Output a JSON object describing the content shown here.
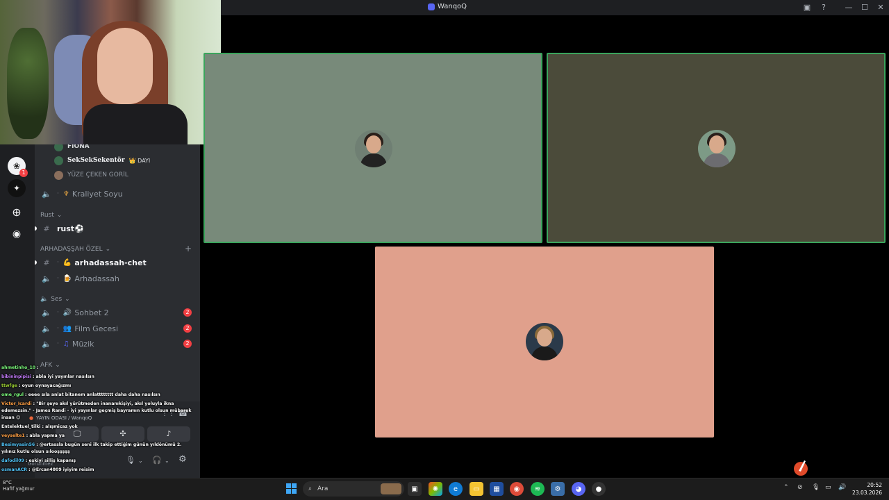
{
  "window": {
    "title": "WanqoQ"
  },
  "webcam": {
    "description_icon": "webcam-feed"
  },
  "rail": {
    "badge_count": "1"
  },
  "members": [
    {
      "name": "FIONA"
    },
    {
      "name": "SekSekSekentör",
      "tag": "DAYI"
    },
    {
      "name": "YÜZE ÇEKEN GORİL"
    }
  ],
  "channels": {
    "kraliyet": {
      "name": "Kraliyet Soyu"
    },
    "rust_category": "Rust",
    "rust_channel": "rust⚽",
    "ozel_category": "ARHADAŞŞAH ÖZEL",
    "arhadassah_chet": "arhadassah-chet",
    "arhadassah_voice": "Arhadassah",
    "ses_category": "Ses",
    "sohbet": {
      "name": "Sohbet 2",
      "badge": "2"
    },
    "film": {
      "name": "Film Gecesi",
      "badge": "2"
    },
    "muzik": {
      "name": "Müzik",
      "badge": "2"
    },
    "afk_category": "AFK"
  },
  "chat": [
    {
      "user": "ahmetinho_10",
      "user_color": "#7CFC7C",
      "text": ":"
    },
    {
      "user": "bibininpipisi",
      "user_color": "#c77dff",
      "text": ": abla iyi yayınlar nasılsın"
    },
    {
      "user": "ttwfge",
      "user_color": "#9acd32",
      "text": ": oyun oynayacağızmı"
    },
    {
      "user": "ome_rgul",
      "user_color": "#7CFC7C",
      "text": ": eeee sıla anlat bitanem anlatttttttt daha daha nasılsın"
    },
    {
      "user": "Victor_Icardi",
      "user_color": "#ff9f43",
      "text": ": \"Bir şeye akıl yürütmeden inananıkişiyi, akıl yoluyla ikna"
    },
    {
      "user": "",
      "user_color": "#ffffff",
      "text": "edemezsin.\" - James Randi - iyi yayınlar geçmiş bayramın kutlu olsun mübarek"
    },
    {
      "user": "",
      "user_color": "#ffffff",
      "text": "insan 😉"
    },
    {
      "user": "Entelektuel_tilki",
      "user_color": "#ffffff",
      "text": ": alışmicaz yok"
    },
    {
      "user": "veyselte1",
      "user_color": "#ff9f43",
      "text": ": abla yapma ya"
    },
    {
      "user": "Besimyasin56",
      "user_color": "#4fc3f7",
      "text": ": @ertassla bugün seni ilk takip ettiğim günün yıldönümü 2."
    },
    {
      "user": "",
      "user_color": "#ffffff",
      "text": "yılınız kutlu olsun sılooşşşşş"
    },
    {
      "user": "dafodil09",
      "user_color": "#4fc3f7",
      "text": ": eskiyi silliş kapanış"
    },
    {
      "user": "osmanACR",
      "user_color": "#4fc3f7",
      "text": ": @Ercan4809 iyiyim reisim"
    }
  ],
  "voice_panel": {
    "status": "YAYIN ODASI / WanqoQ",
    "user_status": "Görünmez"
  },
  "taskbar": {
    "weather_temp": "8°C",
    "weather_text": "Hafif yağmur",
    "search_placeholder": "Ara",
    "time": "20:52",
    "date": "23.03.2026"
  },
  "colors": {
    "tile1": "#788a7a",
    "tile2": "#4b4b3a",
    "tile3": "#e0a08c",
    "speaking": "#3ba55c"
  }
}
